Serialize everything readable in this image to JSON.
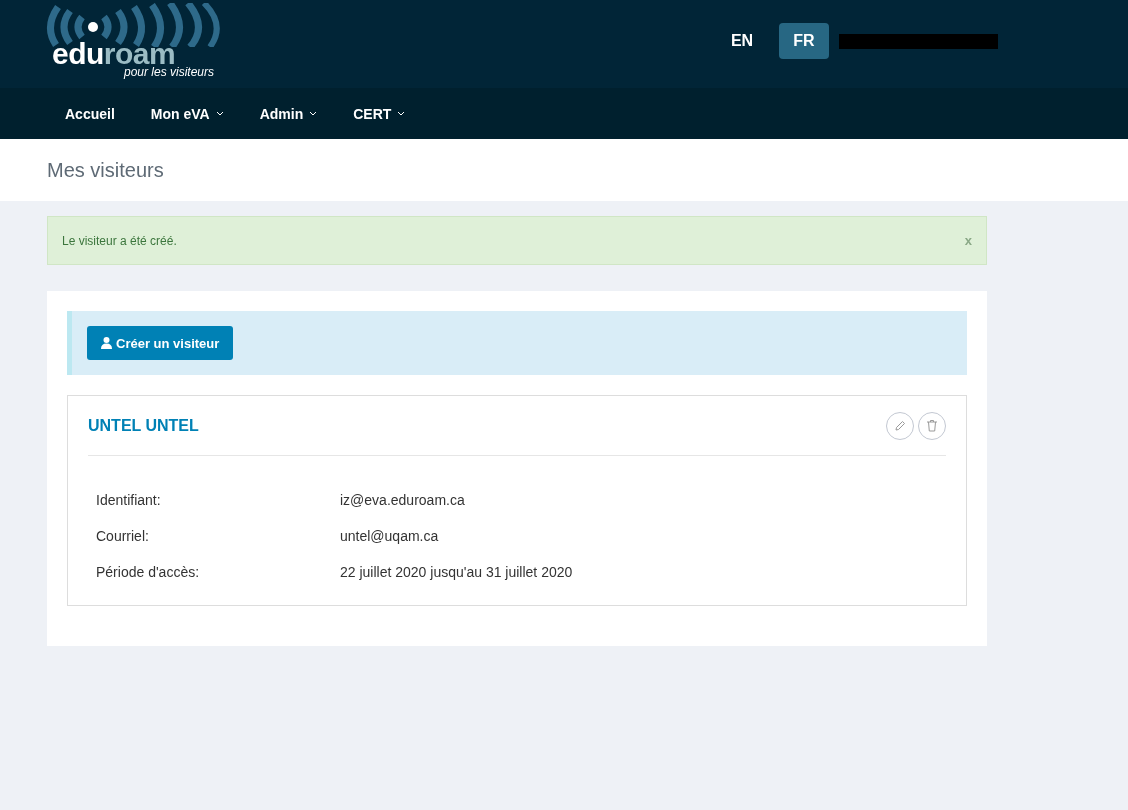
{
  "header": {
    "logo": {
      "parts": [
        "edu",
        "roam"
      ],
      "tagline": "pour les visiteurs"
    },
    "languages": [
      {
        "label": "EN",
        "selected": false
      },
      {
        "label": "FR",
        "selected": true
      }
    ]
  },
  "nav": [
    {
      "label": "Accueil",
      "dropdown": false
    },
    {
      "label": "Mon eVA",
      "dropdown": true
    },
    {
      "label": "Admin",
      "dropdown": true
    },
    {
      "label": "CERT",
      "dropdown": true
    }
  ],
  "page_title": "Mes visiteurs",
  "alert": {
    "message": "Le visiteur a été créé.",
    "close": "x"
  },
  "create_button": "Créer un visiteur",
  "visitor": {
    "name": "UNTEL UNTEL",
    "fields": [
      {
        "label": "Identifiant:",
        "value": "iz@eva.eduroam.ca"
      },
      {
        "label": "Courriel:",
        "value": "untel@uqam.ca"
      },
      {
        "label": "Période d'accès:",
        "value": "22 juillet 2020 jusqu'au 31 juillet 2020"
      }
    ]
  }
}
